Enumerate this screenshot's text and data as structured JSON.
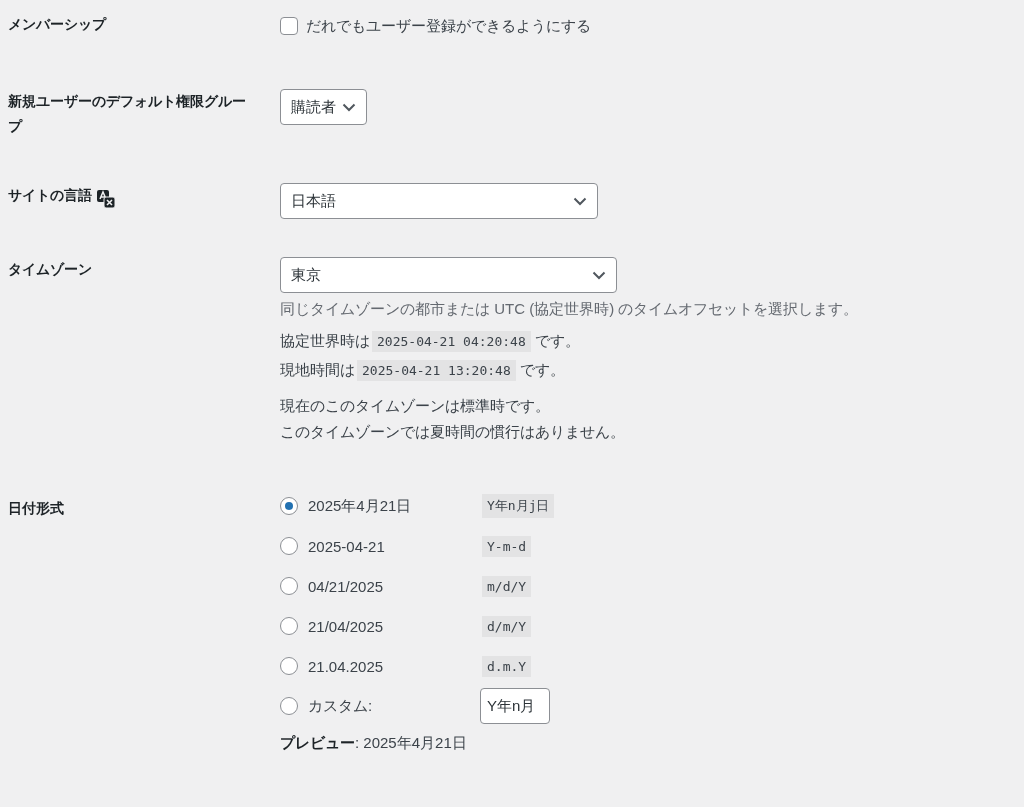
{
  "membership": {
    "label": "メンバーシップ",
    "option": {
      "text": "だれでもユーザー登録ができるようにする",
      "checked": false
    }
  },
  "default_role": {
    "label": "新規ユーザーのデフォルト権限グループ",
    "value": "購読者"
  },
  "site_language": {
    "label": "サイトの言語",
    "value": "日本語"
  },
  "timezone": {
    "label": "タイムゾーン",
    "value": "東京",
    "description": "同じタイムゾーンの都市または UTC (協定世界時) のタイムオフセットを選択します。",
    "times": [
      {
        "prefix": "協定世界時は",
        "time": "2025-04-21 04:20:48",
        "suffix": "です。"
      },
      {
        "prefix": "現地時間は",
        "time": "2025-04-21 13:20:48",
        "suffix": "です。"
      }
    ],
    "notes": [
      "現在のこのタイムゾーンは標準時です。",
      "このタイムゾーンでは夏時間の慣行はありません。"
    ]
  },
  "date_format": {
    "label": "日付形式",
    "options": [
      {
        "kind": "preset",
        "text": "2025年4月21日",
        "format": "Y年n月j日",
        "selected": true
      },
      {
        "kind": "preset",
        "text": "2025-04-21",
        "format": "Y-m-d",
        "selected": false
      },
      {
        "kind": "preset",
        "text": "04/21/2025",
        "format": "m/d/Y",
        "selected": false
      },
      {
        "kind": "preset",
        "text": "21/04/2025",
        "format": "d/m/Y",
        "selected": false
      },
      {
        "kind": "preset",
        "text": "21.04.2025",
        "format": "d.m.Y",
        "selected": false
      },
      {
        "kind": "custom",
        "text": "カスタム:",
        "value": "Y年n月",
        "selected": false
      }
    ],
    "preview": "**プレビュー**: 2025年4月21日"
  }
}
